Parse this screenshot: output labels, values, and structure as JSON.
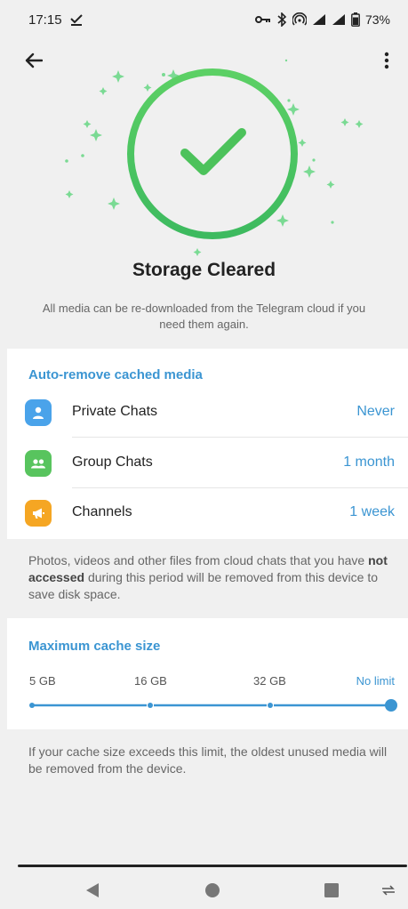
{
  "status_bar": {
    "time": "17:15",
    "battery": "73%"
  },
  "app_bar": {
    "back_icon": "arrow-left-icon",
    "more_icon": "more-vertical-icon"
  },
  "hero": {
    "icon": "check-circle-icon",
    "title": "Storage Cleared",
    "subtitle": "All media can be re-downloaded from the Telegram cloud if you need them again."
  },
  "auto_remove": {
    "header": "Auto-remove cached media",
    "rows": [
      {
        "label": "Private Chats",
        "value": "Never",
        "icon": "person-icon",
        "color": "#4aa3ea"
      },
      {
        "label": "Group Chats",
        "value": "1 month",
        "icon": "group-icon",
        "color": "#58c45e"
      },
      {
        "label": "Channels",
        "value": "1 week",
        "icon": "megaphone-icon",
        "color": "#f5a623"
      }
    ],
    "info_pre": "Photos, videos and other files from cloud chats that you have ",
    "info_bold": "not accessed",
    "info_post": " during this period will be removed from this device to save disk space."
  },
  "cache": {
    "header": "Maximum cache size",
    "options": [
      "5 GB",
      "16 GB",
      "32 GB",
      "No limit"
    ],
    "selected": "No limit",
    "info": "If your cache size exceeds this limit, the oldest unused media will be removed from the device."
  },
  "colors": {
    "accent": "#3b95d2",
    "success": "#4cc25b"
  }
}
